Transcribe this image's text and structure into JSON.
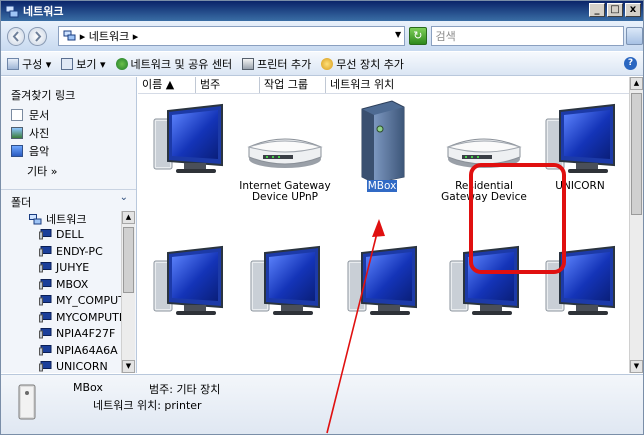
{
  "window": {
    "title": "네트워크",
    "min": "_",
    "max": "□",
    "close": "x"
  },
  "address": {
    "path": "▸ 네트워크 ▸",
    "search_placeholder": "검색"
  },
  "commands": [
    {
      "label": "구성 ▾",
      "icon": "organize-icon"
    },
    {
      "label": "보기 ▾",
      "icon": "view-icon"
    },
    {
      "label": "네트워크 및 공유 센터",
      "icon": "network-center-icon"
    },
    {
      "label": "프린터 추가",
      "icon": "printer-icon"
    },
    {
      "label": "무선 장치 추가",
      "icon": "wireless-icon"
    }
  ],
  "sidebar": {
    "favorites_title": "즐겨찾기 링크",
    "favorites": [
      {
        "label": "문서"
      },
      {
        "label": "사진"
      },
      {
        "label": "음악"
      }
    ],
    "more": "기타  »",
    "folder_title": "폴더",
    "tree_root": "네트워크",
    "tree_items": [
      "DELL",
      "ENDY-PC",
      "JUHYE",
      "MBOX",
      "MY_COMPUT",
      "MYCOMPUTE",
      "NPIA4F27F",
      "NPIA64A6A",
      "UNICORN"
    ]
  },
  "columns": [
    "이름",
    "범주",
    "작업 그룹",
    "네트워크 위치"
  ],
  "devices": [
    {
      "label": "",
      "kind": "computer",
      "row": 0,
      "col": 0
    },
    {
      "label": "Internet Gateway Device UPnP",
      "kind": "router",
      "row": 0,
      "col": 1
    },
    {
      "label": "MBox",
      "kind": "tower",
      "row": 0,
      "col": 2,
      "selected": true
    },
    {
      "label": "Residential Gateway Device",
      "kind": "router",
      "row": 0,
      "col": 3
    },
    {
      "label": "UNICORN",
      "kind": "computer",
      "row": 0,
      "col": 4
    },
    {
      "label": "",
      "kind": "computer",
      "row": 1,
      "col": 0
    },
    {
      "label": "",
      "kind": "computer",
      "row": 1,
      "col": 1
    },
    {
      "label": "",
      "kind": "computer",
      "row": 1,
      "col": 2
    },
    {
      "label": "",
      "kind": "computer",
      "row": 1,
      "col": 3
    },
    {
      "label": "",
      "kind": "computer",
      "row": 1,
      "col": 4
    }
  ],
  "status": {
    "name": "MBox",
    "category": "범주: 기타 장치",
    "location": "네트워크 위치: printer"
  },
  "colors": {
    "accent": "#316ac5",
    "callout": "#e01010"
  }
}
